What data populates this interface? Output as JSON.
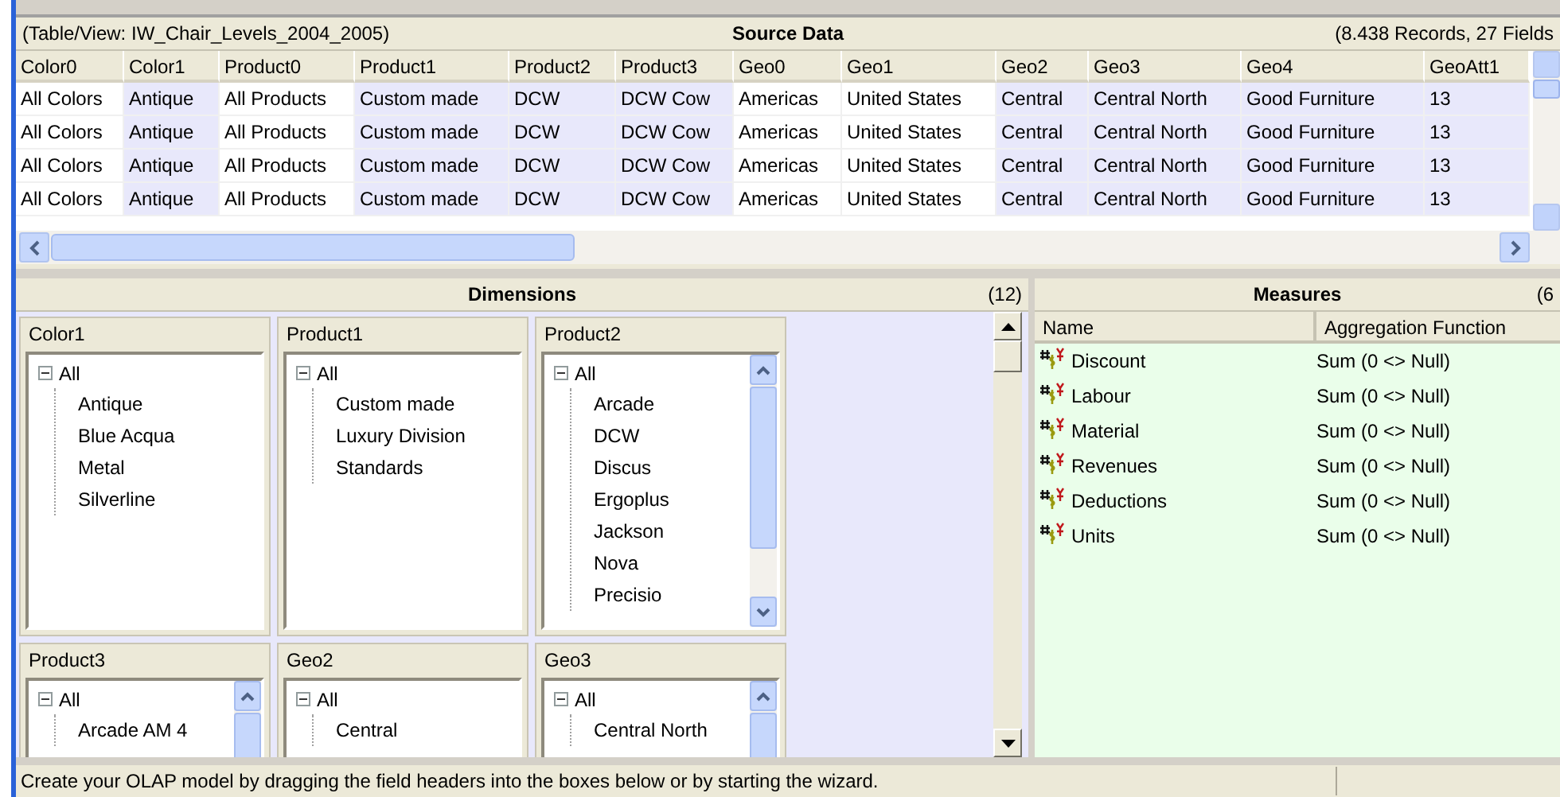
{
  "source_data": {
    "table_view": "(Table/View: IW_Chair_Levels_2004_2005)",
    "title": "Source Data",
    "summary": "(8.438 Records, 27 Fields",
    "columns": [
      {
        "label": "Color0",
        "in_model": false
      },
      {
        "label": "Color1",
        "in_model": true
      },
      {
        "label": "Product0",
        "in_model": false
      },
      {
        "label": "Product1",
        "in_model": true
      },
      {
        "label": "Product2",
        "in_model": true
      },
      {
        "label": "Product3",
        "in_model": true
      },
      {
        "label": "Geo0",
        "in_model": false
      },
      {
        "label": "Geo1",
        "in_model": false
      },
      {
        "label": "Geo2",
        "in_model": true
      },
      {
        "label": "Geo3",
        "in_model": true
      },
      {
        "label": "Geo4",
        "in_model": true
      },
      {
        "label": "GeoAtt1",
        "in_model": true
      }
    ],
    "rows": [
      [
        "All Colors",
        "Antique",
        "All Products",
        "Custom made",
        "DCW",
        "DCW Cow",
        "Americas",
        "United States",
        "Central",
        "Central North",
        "Good Furniture",
        "13"
      ],
      [
        "All Colors",
        "Antique",
        "All Products",
        "Custom made",
        "DCW",
        "DCW Cow",
        "Americas",
        "United States",
        "Central",
        "Central North",
        "Good Furniture",
        "13"
      ],
      [
        "All Colors",
        "Antique",
        "All Products",
        "Custom made",
        "DCW",
        "DCW Cow",
        "Americas",
        "United States",
        "Central",
        "Central North",
        "Good Furniture",
        "13"
      ],
      [
        "All Colors",
        "Antique",
        "All Products",
        "Custom made",
        "DCW",
        "DCW Cow",
        "Americas",
        "United States",
        "Central",
        "Central North",
        "Good Furniture",
        "13"
      ]
    ]
  },
  "dimensions": {
    "title": "Dimensions",
    "count": "(12)",
    "boxes": [
      {
        "label": "Color1",
        "scrollbar": false,
        "tree": {
          "label": "All",
          "expanded": true,
          "children": [
            "Antique",
            "Blue Acqua",
            "Metal",
            "Silverline"
          ]
        }
      },
      {
        "label": "Product1",
        "scrollbar": false,
        "tree": {
          "label": "All",
          "expanded": true,
          "children": [
            "Custom made",
            "Luxury Division",
            "Standards"
          ]
        }
      },
      {
        "label": "Product2",
        "scrollbar": true,
        "tree": {
          "label": "All",
          "expanded": true,
          "children": [
            "Arcade",
            "DCW",
            "Discus",
            "Ergoplus",
            "Jackson",
            "Nova",
            "Precisio"
          ]
        }
      },
      {
        "label": "Product3",
        "scrollbar": true,
        "tree": {
          "label": "All",
          "expanded": true,
          "children": [
            "Arcade AM 4"
          ]
        }
      },
      {
        "label": "Geo2",
        "scrollbar": false,
        "tree": {
          "label": "All",
          "expanded": true,
          "children": [
            "Central"
          ]
        }
      },
      {
        "label": "Geo3",
        "scrollbar": true,
        "tree": {
          "label": "All",
          "expanded": true,
          "children": [
            "Central North"
          ]
        }
      }
    ]
  },
  "measures": {
    "title": "Measures",
    "count": "(6",
    "columns": [
      "Name",
      "Aggregation Function"
    ],
    "rows": [
      {
        "name": "Discount",
        "aggregation": "Sum (0 <> Null)"
      },
      {
        "name": "Labour",
        "aggregation": "Sum (0 <> Null)"
      },
      {
        "name": "Material",
        "aggregation": "Sum (0 <> Null)"
      },
      {
        "name": "Revenues",
        "aggregation": "Sum (0 <> Null)"
      },
      {
        "name": "Deductions",
        "aggregation": "Sum (0 <> Null)"
      },
      {
        "name": "Units",
        "aggregation": "Sum (0 <> Null)"
      }
    ]
  },
  "status_bar": "Create your OLAP model by dragging the field headers into the boxes below or by starting the wizard."
}
